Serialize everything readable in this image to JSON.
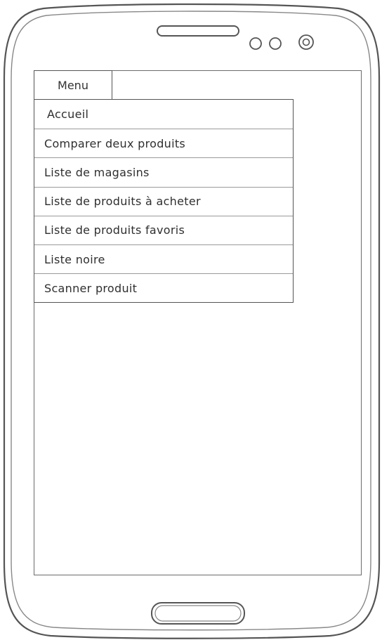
{
  "menu": {
    "tab_label": "Menu",
    "items": [
      {
        "label": "Accueil"
      },
      {
        "label": "Comparer deux produits"
      },
      {
        "label": "Liste de magasins"
      },
      {
        "label": "Liste de produits à acheter"
      },
      {
        "label": "Liste de produits favoris"
      },
      {
        "label": "Liste noire"
      },
      {
        "label": "Scanner produit"
      }
    ]
  },
  "colors": {
    "frame_stroke": "#555555",
    "background": "#ffffff"
  }
}
